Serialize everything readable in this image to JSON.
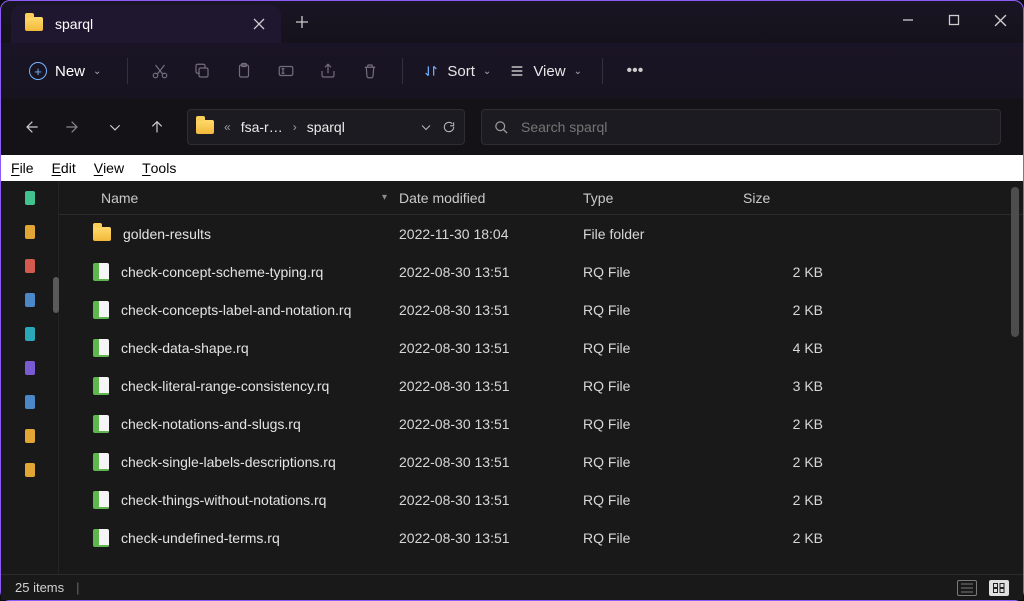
{
  "tab": {
    "title": "sparql"
  },
  "toolbar": {
    "new_label": "New",
    "sort_label": "Sort",
    "view_label": "View"
  },
  "breadcrumb": {
    "ellipsis": "«",
    "crumb1": "fsa-r…",
    "crumb2": "sparql"
  },
  "search": {
    "placeholder": "Search sparql"
  },
  "menubar": {
    "file": "File",
    "edit": "Edit",
    "view": "View",
    "tools": "Tools"
  },
  "columns": {
    "name": "Name",
    "date": "Date modified",
    "type": "Type",
    "size": "Size"
  },
  "rows": [
    {
      "icon": "folder",
      "name": "golden-results",
      "date": "2022-11-30 18:04",
      "type": "File folder",
      "size": ""
    },
    {
      "icon": "file",
      "name": "check-concept-scheme-typing.rq",
      "date": "2022-08-30 13:51",
      "type": "RQ File",
      "size": "2 KB"
    },
    {
      "icon": "file",
      "name": "check-concepts-label-and-notation.rq",
      "date": "2022-08-30 13:51",
      "type": "RQ File",
      "size": "2 KB"
    },
    {
      "icon": "file",
      "name": "check-data-shape.rq",
      "date": "2022-08-30 13:51",
      "type": "RQ File",
      "size": "4 KB"
    },
    {
      "icon": "file",
      "name": "check-literal-range-consistency.rq",
      "date": "2022-08-30 13:51",
      "type": "RQ File",
      "size": "3 KB"
    },
    {
      "icon": "file",
      "name": "check-notations-and-slugs.rq",
      "date": "2022-08-30 13:51",
      "type": "RQ File",
      "size": "2 KB"
    },
    {
      "icon": "file",
      "name": "check-single-labels-descriptions.rq",
      "date": "2022-08-30 13:51",
      "type": "RQ File",
      "size": "2 KB"
    },
    {
      "icon": "file",
      "name": "check-things-without-notations.rq",
      "date": "2022-08-30 13:51",
      "type": "RQ File",
      "size": "2 KB"
    },
    {
      "icon": "file",
      "name": "check-undefined-terms.rq",
      "date": "2022-08-30 13:51",
      "type": "RQ File",
      "size": "2 KB"
    }
  ],
  "status": {
    "items": "25 items"
  }
}
